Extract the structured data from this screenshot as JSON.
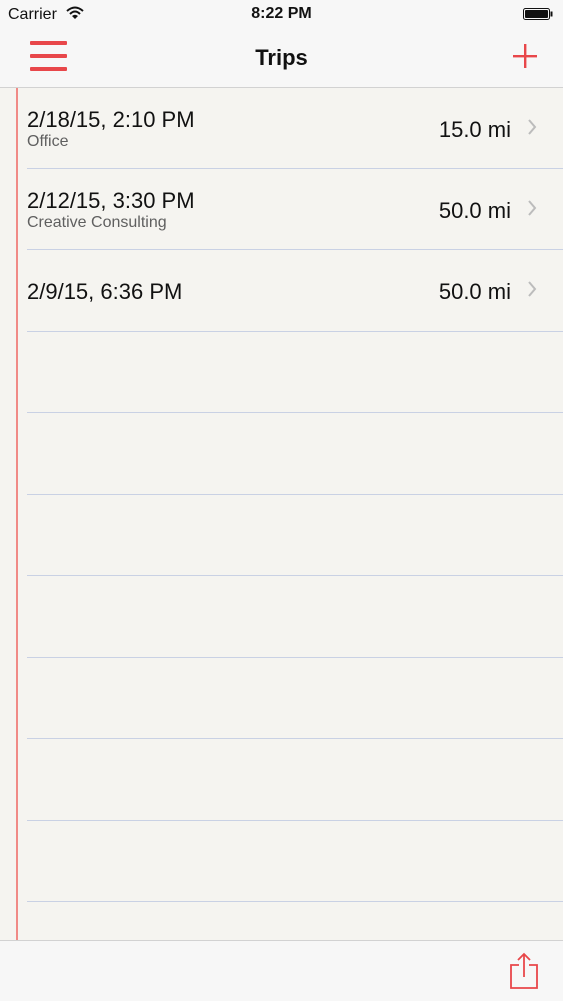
{
  "status_bar": {
    "carrier": "Carrier",
    "time": "8:22 PM"
  },
  "nav": {
    "title": "Trips",
    "menu_icon": "hamburger-menu-icon",
    "add_icon": "plus-icon"
  },
  "trips": [
    {
      "date": "2/18/15, 2:10 PM",
      "client": "Office",
      "distance": "15.0 mi"
    },
    {
      "date": "2/12/15, 3:30 PM",
      "client": "Creative Consulting",
      "distance": "50.0 mi"
    },
    {
      "date": "2/9/15, 6:36 PM",
      "client": "",
      "distance": "50.0 mi"
    }
  ],
  "toolbar": {
    "share_icon": "share-icon"
  },
  "colors": {
    "accent": "#e8474a",
    "paper": "#f5f4f0",
    "rule": "#c9d1e4",
    "margin": "#f08a86"
  }
}
